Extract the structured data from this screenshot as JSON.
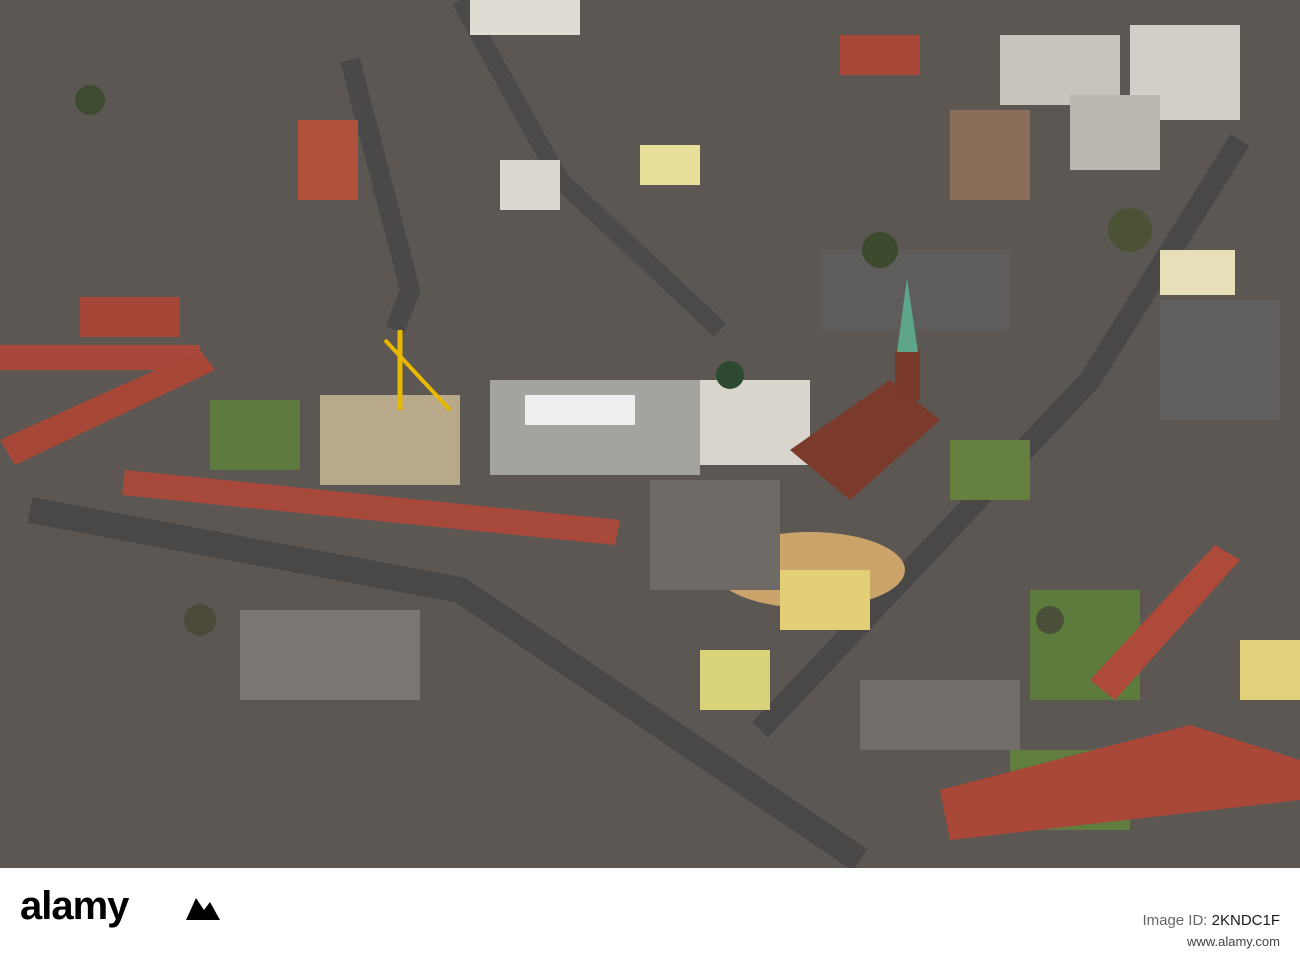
{
  "image": {
    "subject": "aerial-city-view"
  },
  "watermark": {
    "brand": "alamy",
    "stock_id_label": "Image ID:",
    "stock_id_value": "2KNDC1F",
    "site": "www.alamy.com"
  },
  "colors": {
    "roof_red": "#a9483a",
    "roof_grey": "#6e6a66",
    "facade_light": "#d9d4cc",
    "spire_green": "#5fa58a",
    "crane_yellow": "#e6b800",
    "lawn": "#5f7a3e",
    "street": "#55524f",
    "playground_sand": "#caa46b"
  }
}
